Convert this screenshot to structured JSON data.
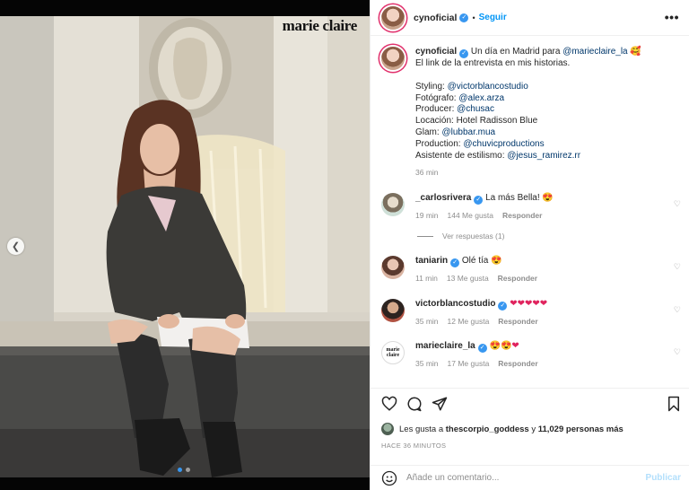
{
  "photo": {
    "brand_logo": "marie claire",
    "prev_icon": "chevron-left-icon",
    "slides_total": 2,
    "slide_active": 1
  },
  "header": {
    "username": "cynoficial",
    "separator": "•",
    "follow_label": "Seguir",
    "more_icon": "more-horizontal-icon",
    "more_label": "•••"
  },
  "caption": {
    "username": "cynoficial",
    "text_pre": "Un día en Madrid para ",
    "mention": "@marieclaire_la",
    "emoji": "🥰",
    "line2": "El link de la entrevista en mis historias.",
    "credits": [
      {
        "label": "Styling: ",
        "handle": "@victorblancostudio"
      },
      {
        "label": "Fotógrafo: ",
        "handle": "@alex.arza"
      },
      {
        "label": "Producer: ",
        "handle": "@chusac"
      },
      {
        "label": "Locación: Hotel Radisson Blue",
        "handle": ""
      },
      {
        "label": "Glam: ",
        "handle": "@lubbar.mua"
      },
      {
        "label": "Production: ",
        "handle": "@chuvicproductions"
      },
      {
        "label": "Asistente de estilismo: ",
        "handle": "@jesus_ramirez.rr"
      }
    ],
    "time": "36 min"
  },
  "comments": [
    {
      "username": "_carlosrivera",
      "text": "La más Bella! 😍",
      "time": "19 min",
      "likes": "144 Me gusta",
      "reply": "Responder"
    },
    {
      "username": "taniarin",
      "text": "Olé tía 😍",
      "time": "11 min",
      "likes": "13 Me gusta",
      "reply": "Responder"
    },
    {
      "username": "victorblancostudio",
      "text": "❤❤❤❤❤",
      "time": "35 min",
      "likes": "12 Me gusta",
      "reply": "Responder"
    },
    {
      "username": "marieclaire_la",
      "text": "😍😍❤",
      "time": "35 min",
      "likes": "17 Me gusta",
      "reply": "Responder"
    }
  ],
  "marieclaire_avatar_text": "marie claire",
  "view_replies": "Ver respuestas (1)",
  "likes": {
    "prefix": "Les gusta a ",
    "user": "thescorpio_goddess",
    "middle": " y ",
    "count": "11,029 personas más"
  },
  "time_ago": "HACE 36 MINUTOS",
  "composer": {
    "placeholder": "Añade un comentario...",
    "post_label": "Publicar",
    "emoji_icon": "smiley-icon"
  },
  "colors": {
    "accent_blue": "#0095f6",
    "verified_blue": "#3897f0",
    "mention": "#00376b",
    "muted": "#8e8e8e"
  }
}
